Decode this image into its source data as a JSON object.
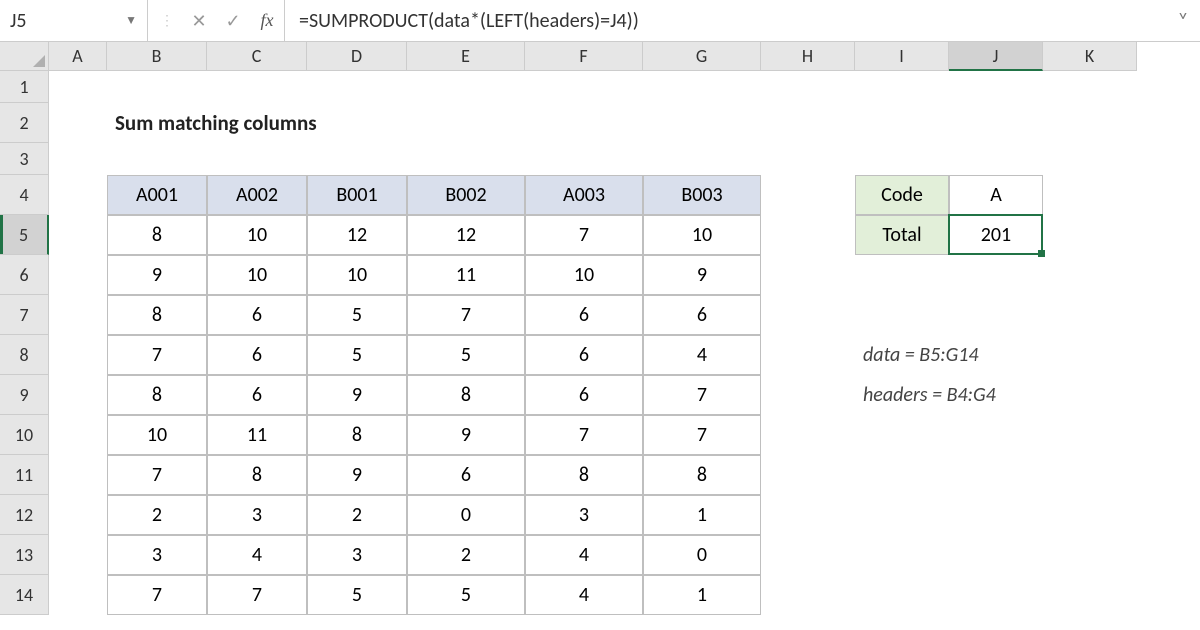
{
  "namebox": "J5",
  "formula": "=SUMPRODUCT(data*(LEFT(headers)=J4))",
  "icons": {
    "dropdown": "▼",
    "cancel": "✕",
    "enter": "✓",
    "fx": "fx",
    "expand": "˅"
  },
  "columns": [
    "A",
    "B",
    "C",
    "D",
    "E",
    "F",
    "G",
    "H",
    "I",
    "J",
    "K"
  ],
  "rows": [
    "1",
    "2",
    "3",
    "4",
    "5",
    "6",
    "7",
    "8",
    "9",
    "10",
    "11",
    "12",
    "13",
    "14"
  ],
  "colWidths": {
    "A": 58,
    "B": 100,
    "C": 100,
    "D": 100,
    "E": 118,
    "F": 118,
    "G": 118,
    "H": 94,
    "I": 94,
    "J": 94,
    "K": 94
  },
  "rowHeights": {
    "1": 32,
    "2": 40,
    "3": 32,
    "4": 40,
    "5": 40,
    "6": 40,
    "7": 40,
    "8": 40,
    "9": 40,
    "10": 40,
    "11": 40,
    "12": 40,
    "13": 40,
    "14": 40
  },
  "activeCell": {
    "row": 5,
    "col": "J"
  },
  "title": "Sum matching columns",
  "headers": [
    "A001",
    "A002",
    "B001",
    "B002",
    "A003",
    "B003"
  ],
  "data": [
    [
      8,
      10,
      12,
      12,
      7,
      10
    ],
    [
      9,
      10,
      10,
      11,
      10,
      9
    ],
    [
      8,
      6,
      5,
      7,
      6,
      6
    ],
    [
      7,
      6,
      5,
      5,
      6,
      4
    ],
    [
      8,
      6,
      9,
      8,
      6,
      7
    ],
    [
      10,
      11,
      8,
      9,
      7,
      7
    ],
    [
      7,
      8,
      9,
      6,
      8,
      8
    ],
    [
      2,
      3,
      2,
      0,
      3,
      1
    ],
    [
      3,
      4,
      3,
      2,
      4,
      0
    ],
    [
      7,
      7,
      5,
      5,
      4,
      1
    ]
  ],
  "summary": {
    "codeLabel": "Code",
    "codeValue": "A",
    "totalLabel": "Total",
    "totalValue": "201"
  },
  "notes": [
    "data = B5:G14",
    "headers = B4:G4"
  ],
  "chart_data": {
    "type": "table",
    "title": "Sum matching columns",
    "categories": [
      "A001",
      "A002",
      "B001",
      "B002",
      "A003",
      "B003"
    ],
    "series": [
      {
        "name": "row5",
        "values": [
          8,
          10,
          12,
          12,
          7,
          10
        ]
      },
      {
        "name": "row6",
        "values": [
          9,
          10,
          10,
          11,
          10,
          9
        ]
      },
      {
        "name": "row7",
        "values": [
          8,
          6,
          5,
          7,
          6,
          6
        ]
      },
      {
        "name": "row8",
        "values": [
          7,
          6,
          5,
          5,
          6,
          4
        ]
      },
      {
        "name": "row9",
        "values": [
          8,
          6,
          9,
          8,
          6,
          7
        ]
      },
      {
        "name": "row10",
        "values": [
          10,
          11,
          8,
          9,
          7,
          7
        ]
      },
      {
        "name": "row11",
        "values": [
          7,
          8,
          9,
          6,
          8,
          8
        ]
      },
      {
        "name": "row12",
        "values": [
          2,
          3,
          2,
          0,
          3,
          1
        ]
      },
      {
        "name": "row13",
        "values": [
          3,
          4,
          3,
          2,
          4,
          0
        ]
      },
      {
        "name": "row14",
        "values": [
          7,
          7,
          5,
          5,
          4,
          1
        ]
      }
    ]
  }
}
